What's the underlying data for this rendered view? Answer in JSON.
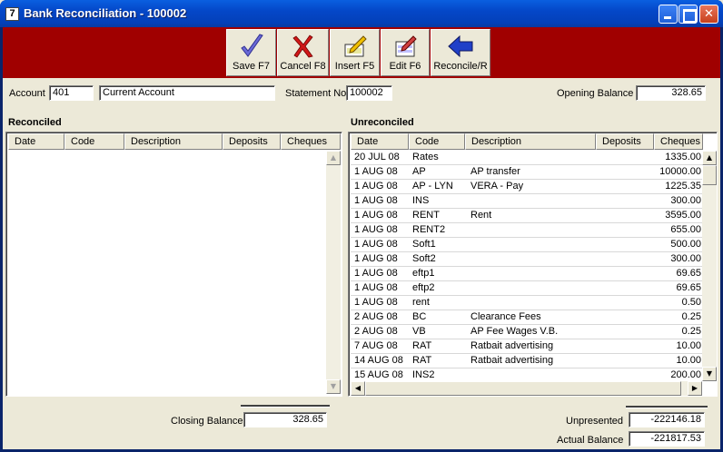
{
  "window": {
    "icon_char": "7",
    "title": "Bank Reconciliation - 100002"
  },
  "toolbar": {
    "save_label": "Save F7",
    "cancel_label": "Cancel F8",
    "insert_label": "Insert F5",
    "edit_label": "Edit F6",
    "reconcile_label": "Reconcile/R"
  },
  "header": {
    "account_label": "Account",
    "account_code": "401",
    "account_name": "Current Account",
    "statement_label": "Statement No",
    "statement_no": "100002",
    "opening_label": "Opening Balance",
    "opening_balance": "328.65"
  },
  "reconciled": {
    "title": "Reconciled",
    "columns": [
      "Date",
      "Code",
      "Description",
      "Deposits",
      "Cheques"
    ],
    "rows": []
  },
  "unreconciled": {
    "title": "Unreconciled",
    "columns": [
      "Date",
      "Code",
      "Description",
      "Deposits",
      "Cheques"
    ],
    "rows": [
      [
        "20 JUL 08",
        "Rates",
        "",
        "",
        "1335.00"
      ],
      [
        "1 AUG 08",
        "AP",
        "AP transfer",
        "",
        "10000.00"
      ],
      [
        "1 AUG 08",
        "AP - LYN",
        "VERA - Pay",
        "",
        "1225.35"
      ],
      [
        "1 AUG 08",
        "INS",
        "",
        "",
        "300.00"
      ],
      [
        "1 AUG 08",
        "RENT",
        "Rent",
        "",
        "3595.00"
      ],
      [
        "1 AUG 08",
        "RENT2",
        "",
        "",
        "655.00"
      ],
      [
        "1 AUG 08",
        "Soft1",
        "",
        "",
        "500.00"
      ],
      [
        "1 AUG 08",
        "Soft2",
        "",
        "",
        "300.00"
      ],
      [
        "1 AUG 08",
        "eftp1",
        "",
        "",
        "69.65"
      ],
      [
        "1 AUG 08",
        "eftp2",
        "",
        "",
        "69.65"
      ],
      [
        "1 AUG 08",
        "rent",
        "",
        "",
        "0.50"
      ],
      [
        "2 AUG 08",
        "BC",
        "Clearance Fees",
        "",
        "0.25"
      ],
      [
        "2 AUG 08",
        "VB",
        "AP Fee Wages V.B.",
        "",
        "0.25"
      ],
      [
        "7 AUG 08",
        "RAT",
        "Ratbait advertising",
        "",
        "10.00"
      ],
      [
        "14 AUG 08",
        "RAT",
        "Ratbait advertising",
        "",
        "10.00"
      ],
      [
        "15 AUG 08",
        "INS2",
        "",
        "",
        "200.00"
      ]
    ]
  },
  "footer": {
    "closing_label": "Closing Balance",
    "closing_balance": "328.65",
    "unpresented_label": "Unpresented",
    "unpresented": "-222146.18",
    "actual_label": "Actual Balance",
    "actual_balance": "-221817.53"
  },
  "colors": {
    "toolbar_band": "#a00000",
    "title_bar": "#0447c8",
    "window_bg": "#ece9d8"
  },
  "icons": {
    "save": "checkmark-icon",
    "cancel": "red-x-icon",
    "insert": "insert-document-icon",
    "edit": "edit-document-icon",
    "reconcile": "blue-left-arrow-icon"
  }
}
